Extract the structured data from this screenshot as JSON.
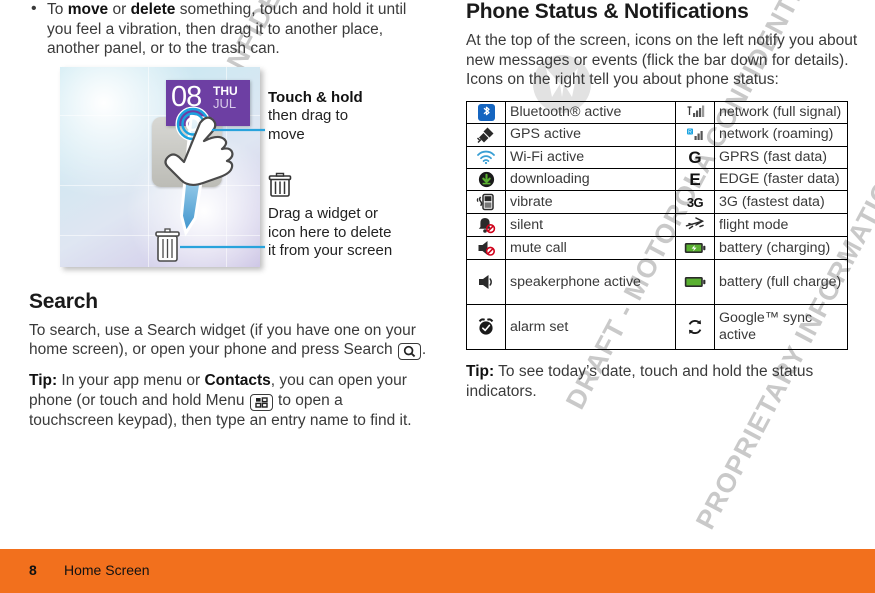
{
  "footer": {
    "page_number": "8",
    "section_title": "Home Screen"
  },
  "watermark": {
    "line_1": "MOTOROLA CONFIDENTIAL PROPRIETARY INFORMATION",
    "line_2": "DRAFT - MOTOROLA CONFIDENTIAL",
    "line_3": "PROPRIETARY INFORMATION",
    "logo": "motorola-batwing-logo"
  },
  "left_column": {
    "bullet_1": {
      "text_before": "To ",
      "bold_1": "move",
      "text_mid": " or ",
      "bold_2": "delete",
      "text_after": " something, touch and hold it until you feel a vibration, then drag it to another place, another panel, or to the trash can."
    },
    "illustration": {
      "widget_day": "08",
      "widget_dow": "THU",
      "widget_month": "JUL",
      "callout_move_heading": "Touch & hold",
      "callout_move_body": "then drag to move",
      "callout_delete_body": "Drag a widget or icon here to delete it from your screen",
      "trash_icon": "trash-can-icon",
      "hand_icon": "hand-pointer-icon"
    },
    "search_section": {
      "heading": "Search",
      "paragraph_before_icon": "To search, use a Search widget (if you have one on your home screen), or open your phone and press Search ",
      "search_key_icon": "search-key-icon",
      "paragraph_after_icon": ".",
      "tip_label": "Tip:",
      "tip_before_bold": " In your app menu or ",
      "tip_bold": "Contacts",
      "tip_before_key": ", you can open your phone (or touch and hold Menu ",
      "menu_key_icon": "menu-key-icon",
      "tip_after_key": " to open a touchscreen keypad), then type an entry name to find it."
    }
  },
  "right_column": {
    "heading": "Phone Status & Notifications",
    "intro": "At the top of the screen, icons on the left notify you about new messages or events (flick the bar down for details). Icons on the right tell you about phone status:",
    "tip_label": "Tip:",
    "tip_text": " To see today’s date, touch and hold the status indicators.",
    "status_table": {
      "rows": [
        {
          "left_icon": "bluetooth-icon",
          "left_label": "Bluetooth® active",
          "right_icon": "signal-full-icon",
          "right_label": "network (full signal)"
        },
        {
          "left_icon": "gps-satellite-icon",
          "left_label": "GPS active",
          "right_icon": "signal-roaming-icon",
          "right_label": "network (roaming)"
        },
        {
          "left_icon": "wifi-icon",
          "left_label": "Wi-Fi active",
          "right_icon": "gprs-g-icon",
          "right_label": "GPRS (fast data)"
        },
        {
          "left_icon": "download-icon",
          "left_label": "downloading",
          "right_icon": "edge-e-icon",
          "right_label": "EDGE (faster data)"
        },
        {
          "left_icon": "vibrate-icon",
          "left_label": "vibrate",
          "right_icon": "three-g-icon",
          "right_label": "3G (fastest data)"
        },
        {
          "left_icon": "silent-bell-icon",
          "left_label": "silent",
          "right_icon": "flight-mode-icon",
          "right_label": "flight mode"
        },
        {
          "left_icon": "mute-call-icon",
          "left_label": "mute call",
          "right_icon": "battery-charging-icon",
          "right_label": "battery (charging)"
        },
        {
          "left_icon": "speakerphone-icon",
          "left_label": "speakerphone active",
          "right_icon": "battery-full-icon",
          "right_label": "battery (full charge)"
        },
        {
          "left_icon": "alarm-clock-icon",
          "left_label": "alarm set",
          "right_icon": "sync-icon",
          "right_label": "Google™ sync active"
        }
      ]
    }
  },
  "colors": {
    "footer_orange": "#f2701d",
    "widget_purple": "#6d3fa3",
    "bluetooth_blue": "#1565c0",
    "battery_green": "#5ab031",
    "accent_line_blue": "#29a3dc",
    "body_text": "#3a3a3a"
  }
}
